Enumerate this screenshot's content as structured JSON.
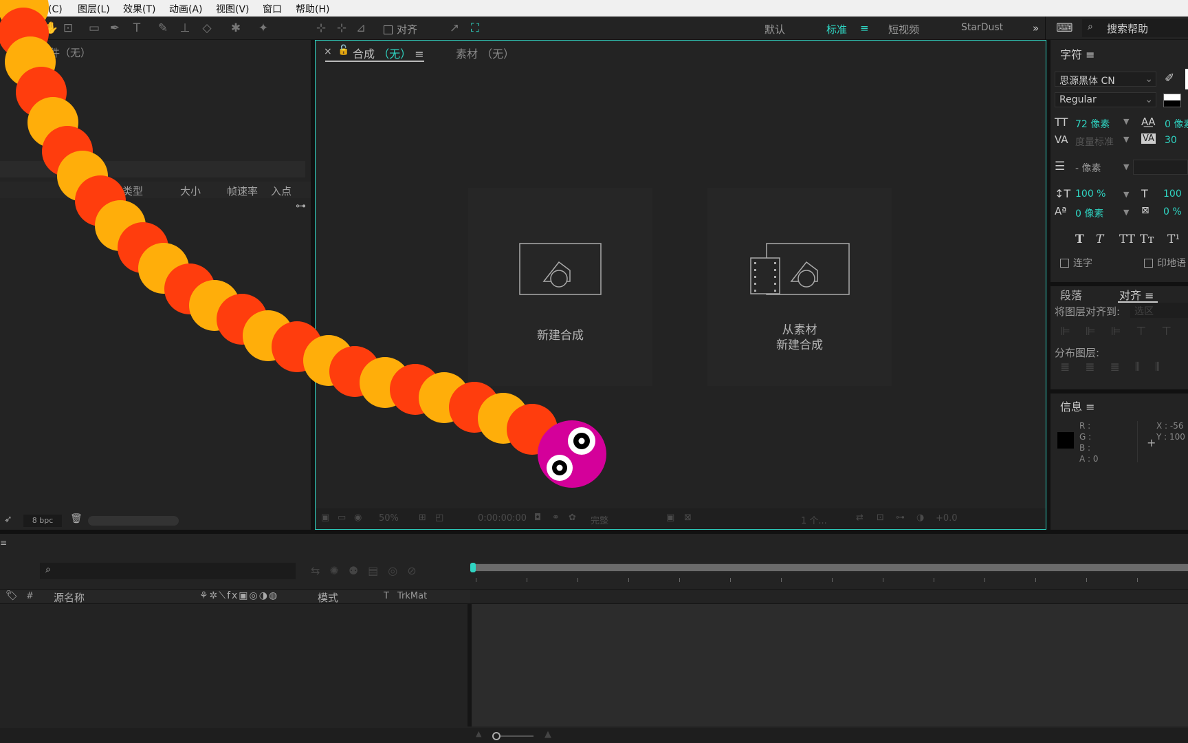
{
  "menu": {
    "composition": "成(C)",
    "layer": "图层(L)",
    "effect": "效果(T)",
    "animation": "动画(A)",
    "view": "视图(V)",
    "window": "窗口",
    "help": "帮助(H)"
  },
  "toolbar": {
    "align_label": "对齐",
    "workspaces": [
      "默认",
      "标准",
      "短视频",
      "StarDust"
    ],
    "search_placeholder": "搜索帮助"
  },
  "project": {
    "header": "件（无）",
    "columns": [
      "类型",
      "大小",
      "帧速率",
      "入点"
    ],
    "bpc": "8 bpc"
  },
  "comp": {
    "tab_label": "合成",
    "tab_value": "（无）",
    "footage_tab": "素材 （无）",
    "new_comp": "新建合成",
    "from_footage_line1": "从素材",
    "from_footage_line2": "新建合成",
    "zoom": "50%",
    "timecode": "0:00:00:00",
    "quality": "完整",
    "views": "1 个...",
    "exposure": "+0.0"
  },
  "character": {
    "title": "字符",
    "font": "思源黑体 CN",
    "style": "Regular",
    "size": "72 像素",
    "kerning": "度量标准",
    "tracking": "30",
    "leading": "0 像素",
    "stroke": "- 像素",
    "vscale": "100 %",
    "hscale": "100",
    "baseline": "0 像素",
    "tsume": "0 %",
    "ligature": "连字",
    "hindi": "印地语"
  },
  "paragraph": {
    "tab": "段落",
    "align_tab": "对齐",
    "align_to": "将图层对齐到:",
    "align_target": "选区",
    "distribute": "分布图层:"
  },
  "info": {
    "title": "信息",
    "r": "R :",
    "g": "G :",
    "b": "B :",
    "a": "A : 0",
    "x": "X : -56",
    "y": "Y : 100"
  },
  "timeline": {
    "col_hash": "#",
    "col_source": "源名称",
    "col_mode": "模式",
    "col_t": "T",
    "col_trkmat": "TrkMat"
  },
  "colors": {
    "accent": "#2fd4c2",
    "worm_red": "#ff3d0d",
    "worm_orange": "#ffae0a",
    "head": "#d4009a"
  }
}
